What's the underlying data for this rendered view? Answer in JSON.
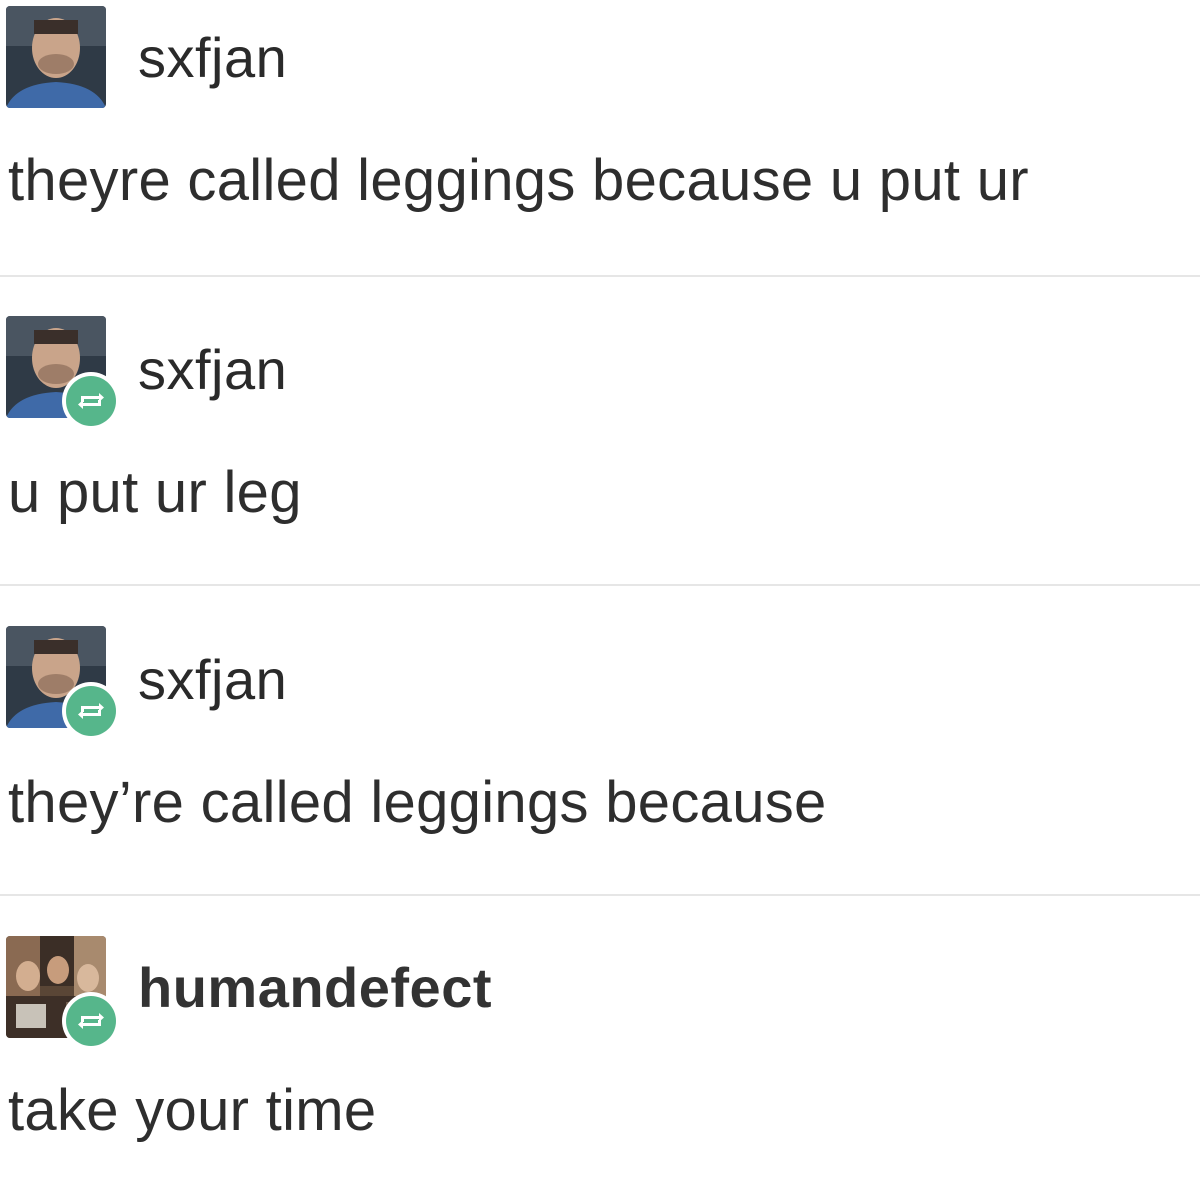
{
  "posts": [
    {
      "username": "sxfjan",
      "text": "theyre called leggings because u put ur",
      "reblog": false,
      "avatar": "man-portrait-avatar"
    },
    {
      "username": "sxfjan",
      "text": "u put ur leg",
      "reblog": true,
      "avatar": "man-portrait-avatar"
    },
    {
      "username": "sxfjan",
      "text": "they’re called leggings because",
      "reblog": true,
      "avatar": "man-portrait-avatar"
    },
    {
      "username": "humandefect",
      "text": "take your time",
      "reblog": true,
      "avatar": "collage-avatar"
    }
  ],
  "colors": {
    "reblog_badge": "#56b68b",
    "divider": "#e6e6e6",
    "text": "#2e2e2e",
    "background": "#ffffff"
  },
  "icons": {
    "reblog": "reblog-arrows-icon"
  }
}
